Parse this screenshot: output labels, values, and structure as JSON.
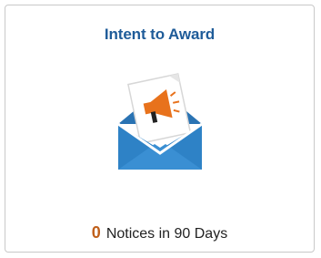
{
  "tile": {
    "title": "Intent to Award",
    "icon": "envelope-megaphone-icon",
    "count": "0",
    "caption": "Notices in 90 Days"
  },
  "colors": {
    "title": "#1f5c99",
    "count": "#c0601b",
    "envelope": "#2e82c6",
    "envelope_dark": "#1f5c99",
    "megaphone": "#e8721c",
    "letter": "#ffffff",
    "border": "#c9c9c9"
  }
}
